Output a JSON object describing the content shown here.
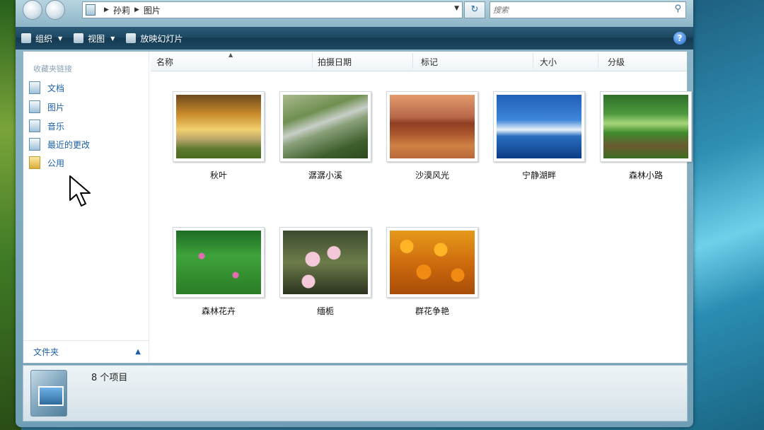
{
  "address": {
    "crumbs": [
      "孙莉",
      "图片"
    ]
  },
  "search": {
    "placeholder": "搜索"
  },
  "toolbar": {
    "organize": "组织",
    "views": "视图",
    "slideshow": "放映幻灯片"
  },
  "sidebar": {
    "heading": "收藏夹链接",
    "items": [
      {
        "label": "文档",
        "icon": "document-icon"
      },
      {
        "label": "图片",
        "icon": "picture-icon"
      },
      {
        "label": "音乐",
        "icon": "music-icon"
      },
      {
        "label": "最近的更改",
        "icon": "recent-changes-icon"
      },
      {
        "label": "公用",
        "icon": "folder-icon"
      }
    ],
    "folders_label": "文件夹"
  },
  "columns": [
    "名称",
    "拍摄日期",
    "标记",
    "大小",
    "分级"
  ],
  "thumbnails": [
    {
      "caption": "秋叶"
    },
    {
      "caption": "潺潺小溪"
    },
    {
      "caption": "沙漠风光"
    },
    {
      "caption": "宁静湖畔"
    },
    {
      "caption": "森林小路"
    },
    {
      "caption": "森林花卉"
    },
    {
      "caption": "缅栀"
    },
    {
      "caption": "群花争艳"
    }
  ],
  "details": {
    "count": "8 个项目"
  },
  "help": "?"
}
